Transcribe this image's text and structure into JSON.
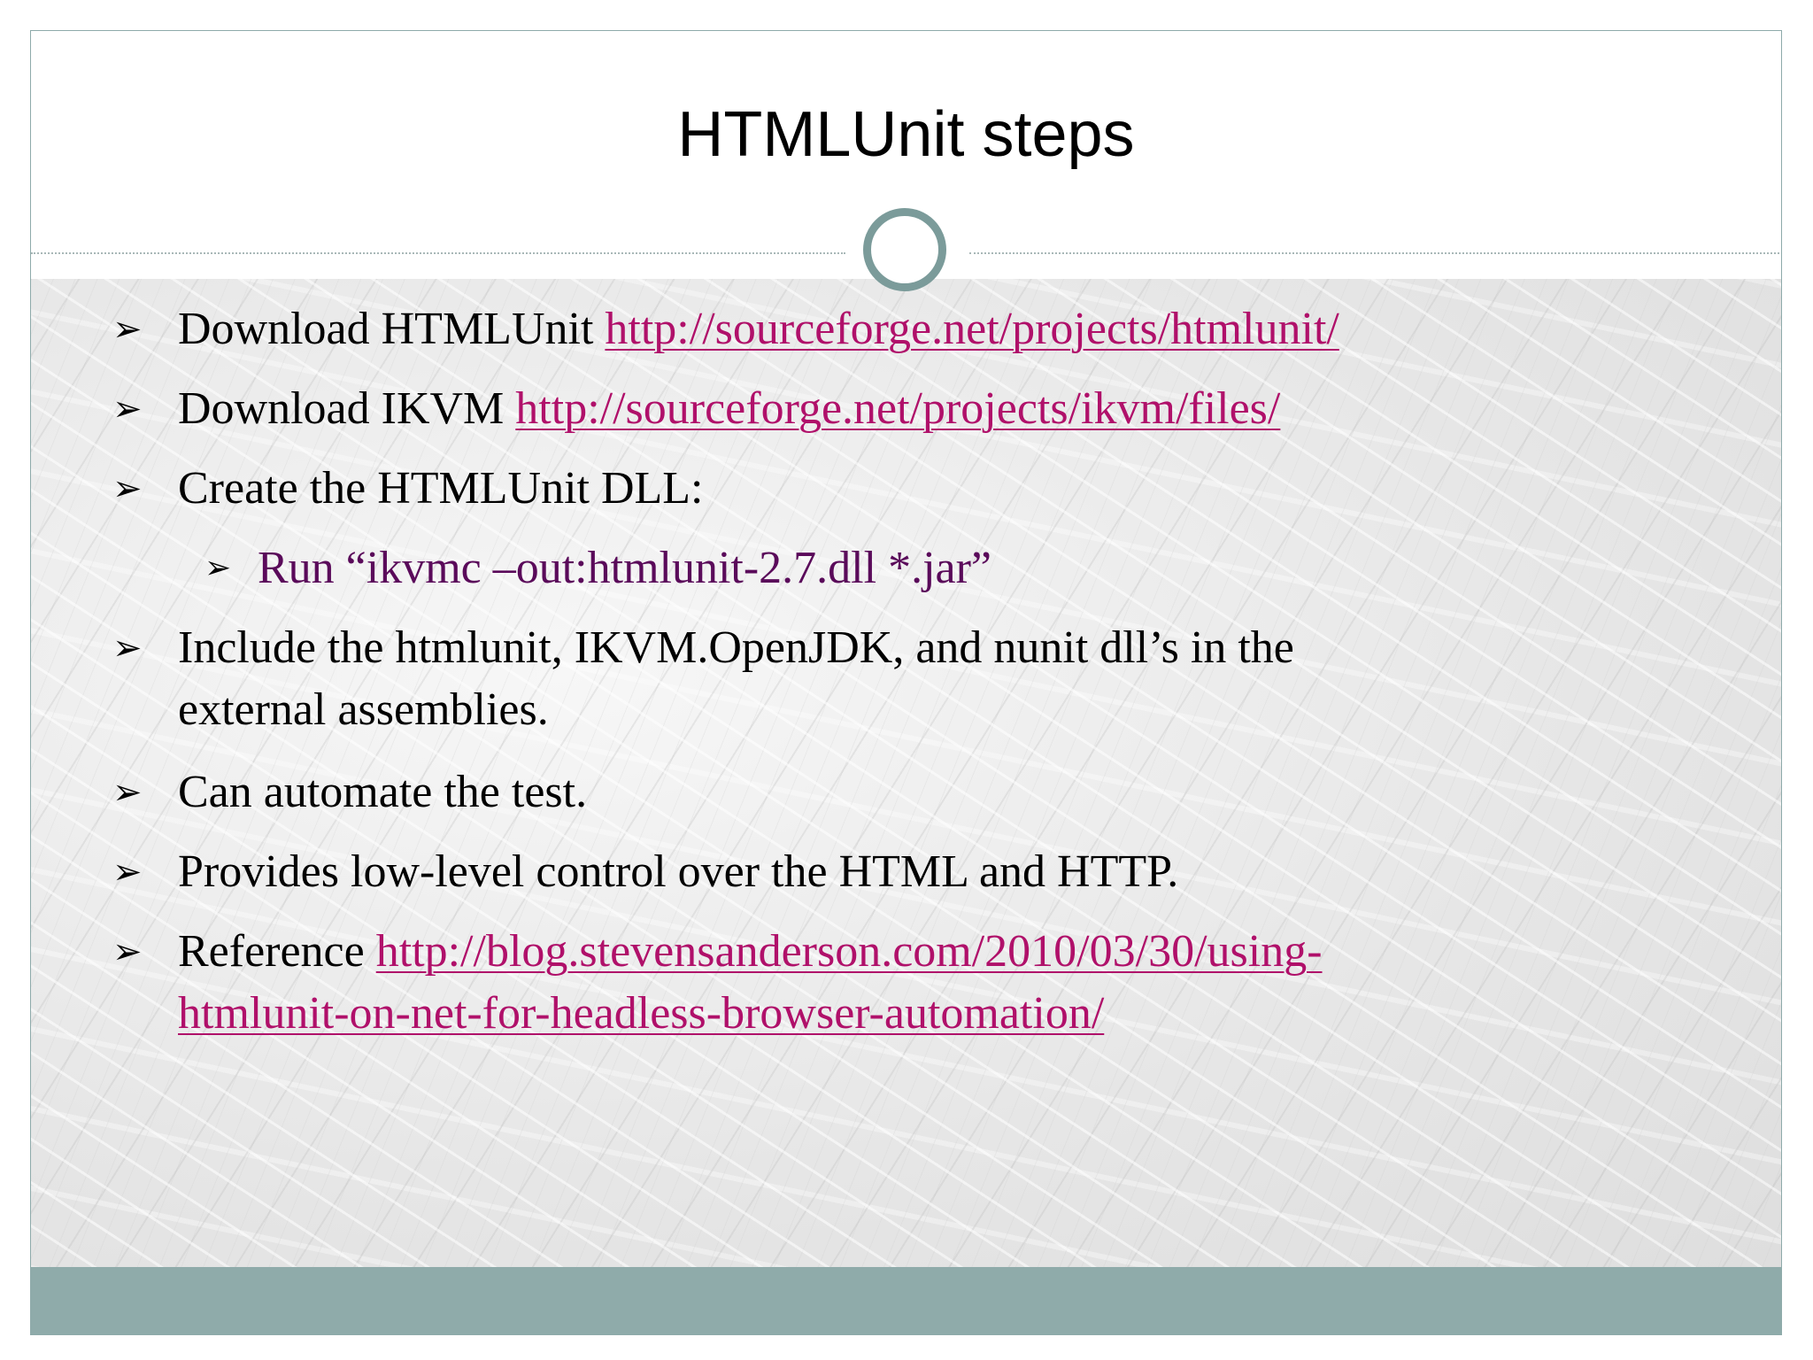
{
  "slide": {
    "title": "HTMLUnit steps",
    "bullet_glyph": "➢",
    "items": [
      {
        "label": "Download HTMLUnit ",
        "link": "http://sourceforge.net/projects/htmlunit/"
      },
      {
        "label": "Download IKVM ",
        "link": "http://sourceforge.net/projects/ikvm/files/"
      },
      {
        "label": "Create the HTMLUnit DLL:"
      },
      {
        "label": "Run  “ikvmc –out:htmlunit-2.7.dll *.jar”"
      },
      {
        "label": "Include the htmlunit, IKVM.OpenJDK, and nunit dll’s in the",
        "label2": "external assemblies."
      },
      {
        "label": "Can automate the test."
      },
      {
        "label": "Provides low-level control over the HTML and HTTP."
      },
      {
        "label": "Reference ",
        "link": "http://blog.stevensanderson.com/2010/03/30/using-",
        "link2": "htmlunit-on-net-for-headless-browser-automation/"
      }
    ]
  },
  "colors": {
    "accent": "#7b9b9a",
    "footer": "#8fabaa",
    "link": "#b0106a",
    "sub_bullet_text": "#5a0a5a"
  }
}
